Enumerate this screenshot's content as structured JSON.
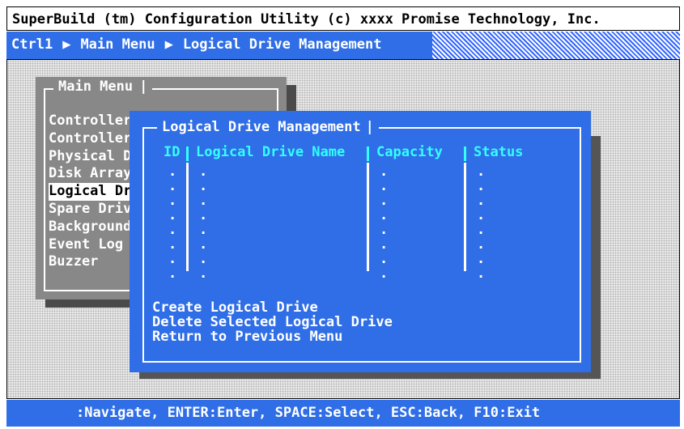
{
  "title_bar": {
    "text": "SuperBuild (tm) Configuration Utility (c) xxxx Promise Technology, Inc."
  },
  "breadcrumb": {
    "items": [
      "Ctrl1",
      "Main Menu",
      "Logical Drive Management"
    ],
    "separator": "▶"
  },
  "main_menu": {
    "caption": "Main Menu",
    "items": [
      {
        "label": "Controller"
      },
      {
        "label": "Controller"
      },
      {
        "label": "Physical D"
      },
      {
        "label": "Disk Array"
      },
      {
        "label": "Logical Dr"
      },
      {
        "label": "Spare Driv"
      },
      {
        "label": "Background"
      },
      {
        "label": "Event Log"
      },
      {
        "label": "Buzzer"
      }
    ],
    "selected_index": 4
  },
  "logical_drive_window": {
    "caption": "Logical Drive Management",
    "columns": {
      "id": "ID",
      "name": "Logical Drive Name",
      "capacity": "Capacity",
      "status": "Status"
    },
    "placeholder": ".",
    "actions": [
      "Create Logical Drive",
      "Delete Selected Logical Drive",
      "Return to Previous Menu"
    ]
  },
  "status_bar": {
    "text": ":Navigate, ENTER:Enter, SPACE:Select, ESC:Back, F10:Exit"
  },
  "colors": {
    "blue": "#2f6ee6",
    "cyan": "#33ffff",
    "gray": "#888888",
    "shadow": "#4a4a4a"
  }
}
